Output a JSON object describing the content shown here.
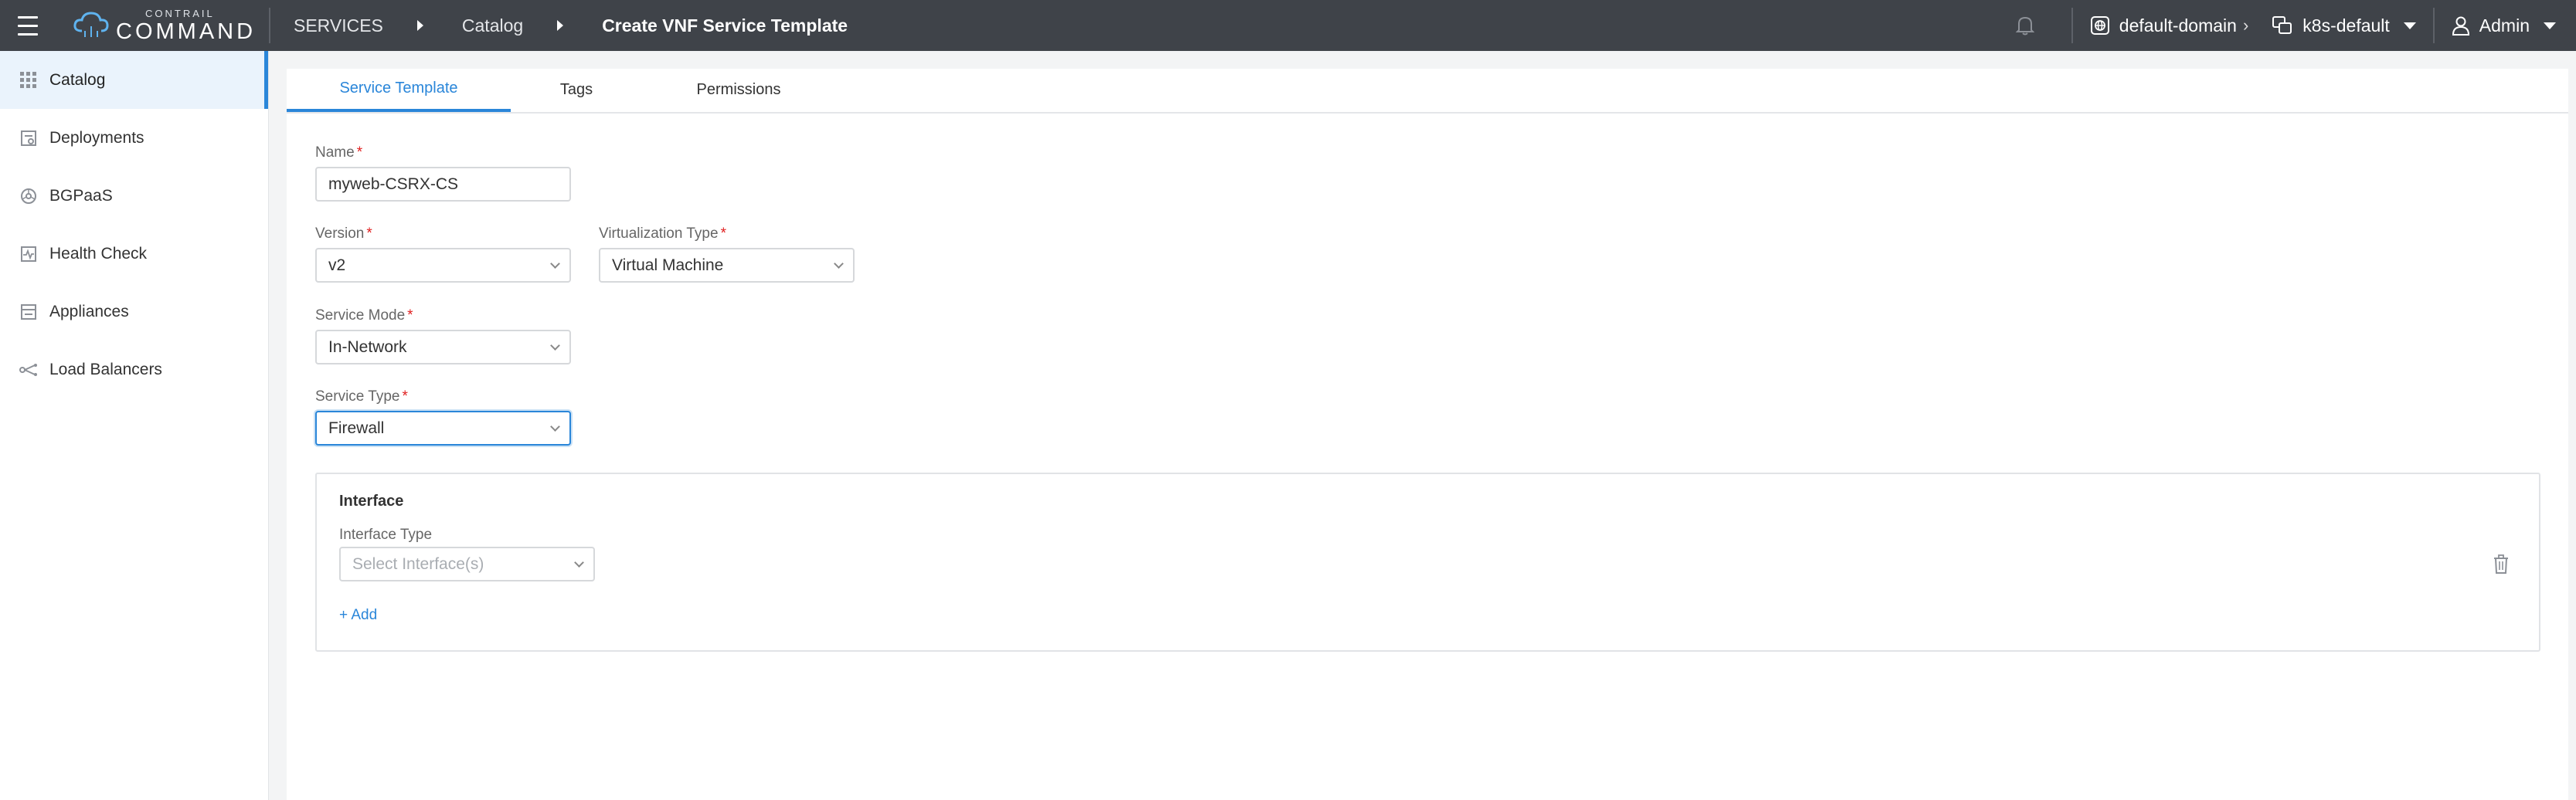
{
  "header": {
    "menu_icon": "hamburger-icon",
    "logo": {
      "small": "CONTRAIL",
      "big": "COMMAND"
    },
    "breadcrumb": [
      "SERVICES",
      "Catalog",
      "Create VNF Service Template"
    ],
    "domain": "default-domain",
    "project": "k8s-default",
    "user": "Admin"
  },
  "sidebar": {
    "items": [
      {
        "label": "Catalog",
        "icon": "grid-icon",
        "active": true
      },
      {
        "label": "Deployments",
        "icon": "deployments-icon"
      },
      {
        "label": "BGPaaS",
        "icon": "bgpaas-icon"
      },
      {
        "label": "Health Check",
        "icon": "health-check-icon"
      },
      {
        "label": "Appliances",
        "icon": "appliances-icon"
      },
      {
        "label": "Load Balancers",
        "icon": "load-balancer-icon"
      }
    ]
  },
  "tabs": [
    "Service Template",
    "Tags",
    "Permissions"
  ],
  "form": {
    "name": {
      "label": "Name",
      "value": "myweb-CSRX-CS"
    },
    "version": {
      "label": "Version",
      "value": "v2"
    },
    "virtualization_type": {
      "label": "Virtualization Type",
      "value": "Virtual Machine"
    },
    "service_mode": {
      "label": "Service Mode",
      "value": "In-Network"
    },
    "service_type": {
      "label": "Service Type",
      "value": "Firewall"
    },
    "required_marker": "*"
  },
  "interface_panel": {
    "title": "Interface",
    "type_label": "Interface Type",
    "type_placeholder": "Select Interface(s)",
    "add_label": "+ Add"
  },
  "colors": {
    "accent": "#2a86d9",
    "topbar": "#3f4349",
    "required": "#e02020"
  }
}
